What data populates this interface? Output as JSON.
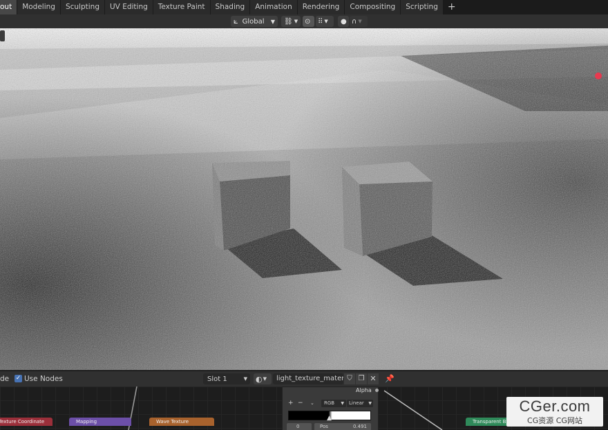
{
  "workspace_tabs": [
    {
      "label": "out",
      "active": true
    },
    {
      "label": "Modeling",
      "active": false
    },
    {
      "label": "Sculpting",
      "active": false
    },
    {
      "label": "UV Editing",
      "active": false
    },
    {
      "label": "Texture Paint",
      "active": false
    },
    {
      "label": "Shading",
      "active": false
    },
    {
      "label": "Animation",
      "active": false
    },
    {
      "label": "Rendering",
      "active": false
    },
    {
      "label": "Compositing",
      "active": false
    },
    {
      "label": "Scripting",
      "active": false
    }
  ],
  "add_workspace_label": "+",
  "header": {
    "orientation_label": "Global"
  },
  "node_editor_header": {
    "mode_label": "de",
    "use_nodes_label": "Use Nodes",
    "use_nodes_checked": true,
    "slot_label": "Slot 1",
    "material_name": "light_texture_materi..."
  },
  "nodes": [
    {
      "label": "Texture Coordinate",
      "color": "#9b2f3a"
    },
    {
      "label": "Mapping",
      "color": "#6c4fa8"
    },
    {
      "label": "Wave Texture",
      "color": "#a8622d"
    },
    {
      "label": "Transparent BS",
      "color": "#2f8a5a"
    }
  ],
  "color_ramp": {
    "alpha_label": "Alpha",
    "plus_label": "+",
    "minus_label": "−",
    "color_mode": "RGB",
    "interpolation": "Linear",
    "index_value": "0",
    "pos_label": "Pos",
    "pos_value": "0.491"
  },
  "watermark": {
    "title": "CGer.com",
    "subtitle": "CG资源 CG网站"
  },
  "colors": {
    "accent": "#4772b3",
    "viewport_bg": "#8a8a8a",
    "red_gizmo": "#e8394f"
  }
}
